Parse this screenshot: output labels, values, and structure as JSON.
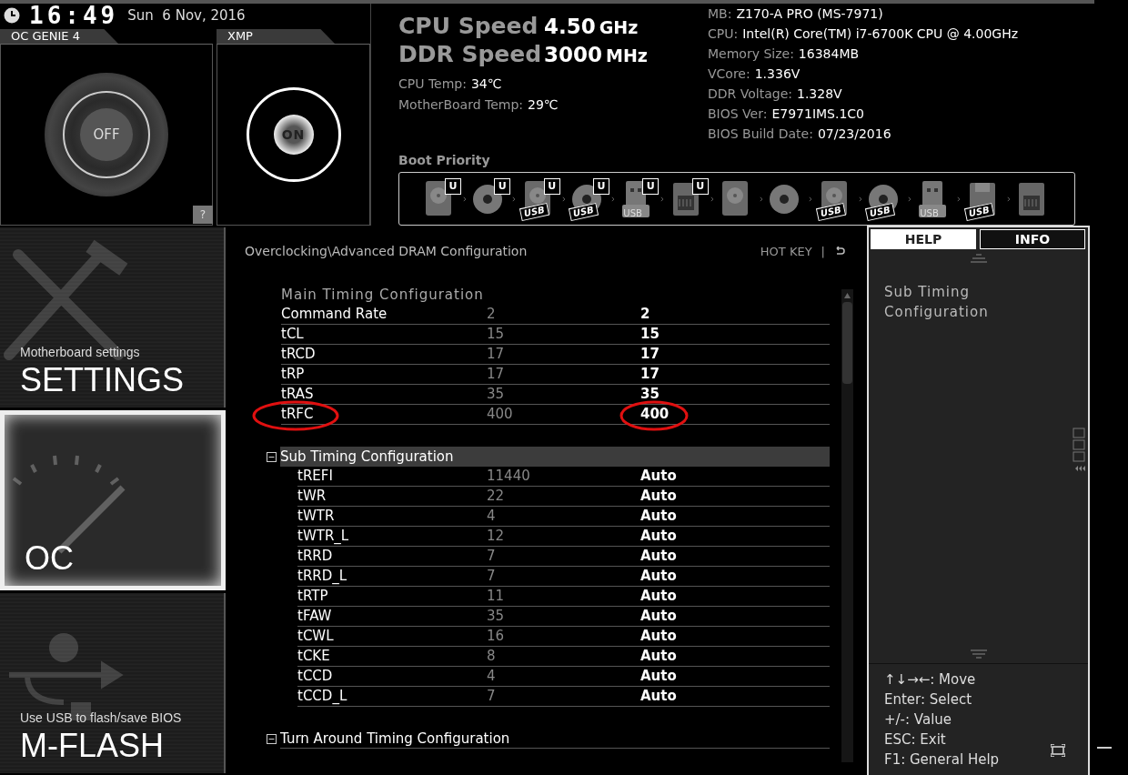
{
  "clock": {
    "time": "16:49",
    "date": "Sun  6 Nov, 2016"
  },
  "toggles": [
    {
      "label": "OC GENIE 4",
      "state": "OFF",
      "on": false
    },
    {
      "label": "XMP",
      "state": "ON",
      "on": true
    }
  ],
  "help_button": "?",
  "speeds": [
    {
      "label": "CPU Speed",
      "value": "4.50",
      "unit": "GHz"
    },
    {
      "label": "DDR Speed",
      "value": "3000",
      "unit": "MHz"
    }
  ],
  "temps": [
    {
      "label": "CPU Temp:",
      "value": "34℃"
    },
    {
      "label": "MotherBoard Temp:",
      "value": "29℃"
    }
  ],
  "system_info": [
    {
      "label": "MB:",
      "value": "Z170-A PRO (MS-7971)"
    },
    {
      "label": "CPU:",
      "value": "Intel(R) Core(TM) i7-6700K CPU @ 4.00GHz"
    },
    {
      "label": "Memory Size:",
      "value": "16384MB"
    },
    {
      "label": "VCore:",
      "value": "1.336V"
    },
    {
      "label": "DDR Voltage:",
      "value": "1.328V"
    },
    {
      "label": "BIOS Ver:",
      "value": "E7971IMS.1C0"
    },
    {
      "label": "BIOS Build Date:",
      "value": "07/23/2016"
    }
  ],
  "boot_priority": {
    "title": "Boot Priority",
    "devices": [
      {
        "kind": "hdd",
        "badge": "U"
      },
      {
        "kind": "optical",
        "badge": "U"
      },
      {
        "kind": "hdd",
        "badge": "U",
        "usb": "USB"
      },
      {
        "kind": "optical",
        "badge": "U",
        "usb": "USB"
      },
      {
        "kind": "usbkey",
        "badge": "U",
        "usb": "USB"
      },
      {
        "kind": "network",
        "badge": "U"
      },
      {
        "kind": "hdd"
      },
      {
        "kind": "optical"
      },
      {
        "kind": "hdd",
        "usb": "USB"
      },
      {
        "kind": "optical",
        "usb": "USB"
      },
      {
        "kind": "usbkey",
        "usb": "USB"
      },
      {
        "kind": "floppy",
        "usb": "USB"
      },
      {
        "kind": "network"
      }
    ]
  },
  "sidebar": [
    {
      "kind": "settings",
      "subtitle": "Motherboard settings",
      "title": "SETTINGS",
      "selected": false
    },
    {
      "kind": "oc",
      "title": "OC",
      "selected": true
    },
    {
      "kind": "mflash",
      "subtitle": "Use USB to flash/save BIOS",
      "title": "M-FLASH",
      "selected": false
    }
  ],
  "breadcrumb": "Overclocking\\Advanced DRAM Configuration",
  "hotkey": {
    "label": "HOT KEY",
    "separator": "|"
  },
  "sections": [
    {
      "title": "Main Timing Configuration",
      "kind": "heading",
      "rows": [
        {
          "name": "Command Rate",
          "default": "2",
          "value": "2",
          "circled": false
        },
        {
          "name": "tCL",
          "default": "15",
          "value": "15",
          "circled": false
        },
        {
          "name": "tRCD",
          "default": "17",
          "value": "17",
          "circled": false
        },
        {
          "name": "tRP",
          "default": "17",
          "value": "17",
          "circled": false
        },
        {
          "name": "tRAS",
          "default": "35",
          "value": "35",
          "circled": false
        },
        {
          "name": "tRFC",
          "default": "400",
          "value": "400",
          "circled": true
        }
      ]
    },
    {
      "title": "Sub Timing Configuration",
      "kind": "group",
      "expanded": true,
      "selected": true,
      "rows": [
        {
          "name": "tREFI",
          "default": "11440",
          "value": "Auto"
        },
        {
          "name": "tWR",
          "default": "22",
          "value": "Auto"
        },
        {
          "name": "tWTR",
          "default": "4",
          "value": "Auto"
        },
        {
          "name": "tWTR_L",
          "default": "12",
          "value": "Auto"
        },
        {
          "name": "tRRD",
          "default": "7",
          "value": "Auto"
        },
        {
          "name": "tRRD_L",
          "default": "7",
          "value": "Auto"
        },
        {
          "name": "tRTP",
          "default": "11",
          "value": "Auto"
        },
        {
          "name": "tFAW",
          "default": "35",
          "value": "Auto"
        },
        {
          "name": "tCWL",
          "default": "16",
          "value": "Auto"
        },
        {
          "name": "tCKE",
          "default": "8",
          "value": "Auto"
        },
        {
          "name": "tCCD",
          "default": "4",
          "value": "Auto"
        },
        {
          "name": "tCCD_L",
          "default": "7",
          "value": "Auto"
        }
      ]
    },
    {
      "title": "Turn Around Timing Configuration",
      "kind": "group",
      "expanded": true,
      "selected": false
    }
  ],
  "help_panel": {
    "tabs": [
      {
        "label": "HELP",
        "selected": true
      },
      {
        "label": "INFO",
        "selected": false
      }
    ],
    "text": "Sub Timing Configuration",
    "keys": [
      "↑↓→←: Move",
      "Enter: Select",
      "+/-: Value",
      "ESC: Exit",
      "F1: General Help"
    ]
  }
}
